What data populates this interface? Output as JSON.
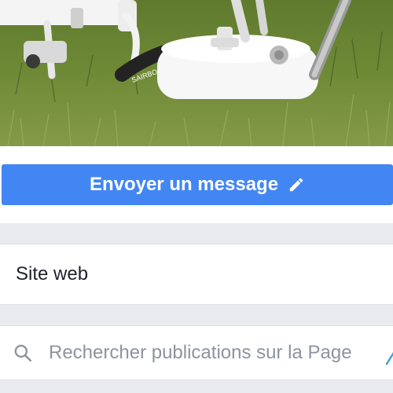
{
  "cover_photo": {
    "description_icon": "drone-photo",
    "strap_text": "SAIRBO"
  },
  "actions": {
    "message_button_label": "Envoyer un message",
    "message_button_icon": "pencil-icon",
    "button_color": "#4286f4"
  },
  "about": {
    "website_label": "Site web"
  },
  "search": {
    "placeholder": "Rechercher publications sur la Page",
    "icon": "search-icon"
  }
}
